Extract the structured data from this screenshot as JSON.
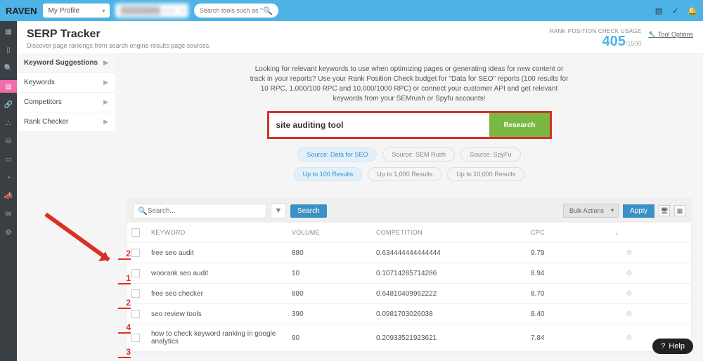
{
  "top": {
    "logo": "RAVEN",
    "profile": "My Profile",
    "domain": "████████.com",
    "search_placeholder": "Search tools such as \"facebook\""
  },
  "header": {
    "title": "SERP Tracker",
    "subtitle": "Discover page rankings from search engine results page sources.",
    "usage_label": "RANK POSITION CHECK USAGE",
    "usage_value": "405",
    "usage_max": "/1500",
    "tool_options": "Tool Options"
  },
  "sidebar": {
    "items": [
      {
        "label": "Keyword Suggestions"
      },
      {
        "label": "Keywords"
      },
      {
        "label": "Competitors"
      },
      {
        "label": "Rank Checker"
      }
    ]
  },
  "intro": "Looking for relevant keywords to use when optimizing pages or generating ideas for new content or track in your reports? Use your Rank Position Check budget for \"Data for SEO\" reports (100 results for 10 RPC, 1,000/100 RPC and 10,000/1000 RPC) or connect your customer API and get relevant keywords from your SEMrush or Spyfu accounts!",
  "research": {
    "input": "site auditing tool",
    "button": "Research"
  },
  "sources": {
    "items": [
      "Source: Data for SEO",
      "Source: SEM Rush",
      "Source: SpyFu"
    ]
  },
  "ranges": {
    "items": [
      "Up to 100 Results",
      "Up to 1,000 Results",
      "Up to 10,000 Results"
    ]
  },
  "table": {
    "search_placeholder": "Search...",
    "search_button": "Search",
    "bulk": "Bulk Actions",
    "apply": "Apply",
    "headers": {
      "keyword": "KEYWORD",
      "volume": "VOLUME",
      "competition": "COMPETITION",
      "cpc": "CPC"
    },
    "rows": [
      {
        "rank": "2",
        "keyword": "free seo audit",
        "volume": "880",
        "competition": "0.634444444444444",
        "cpc": "9.79"
      },
      {
        "rank": "1",
        "keyword": "woorank seo audit",
        "volume": "10",
        "competition": "0.10714285714286",
        "cpc": "8.94"
      },
      {
        "rank": "2",
        "keyword": "free seo checker",
        "volume": "880",
        "competition": "0.64810409962222",
        "cpc": "8.70"
      },
      {
        "rank": "4",
        "keyword": "seo review tools",
        "volume": "390",
        "competition": "0.0981703026038",
        "cpc": "8.40"
      },
      {
        "rank": "3",
        "keyword": "how to check keyword ranking in google analytics",
        "volume": "90",
        "competition": "0.20933521923621",
        "cpc": "7.84"
      }
    ]
  },
  "help": "Help"
}
